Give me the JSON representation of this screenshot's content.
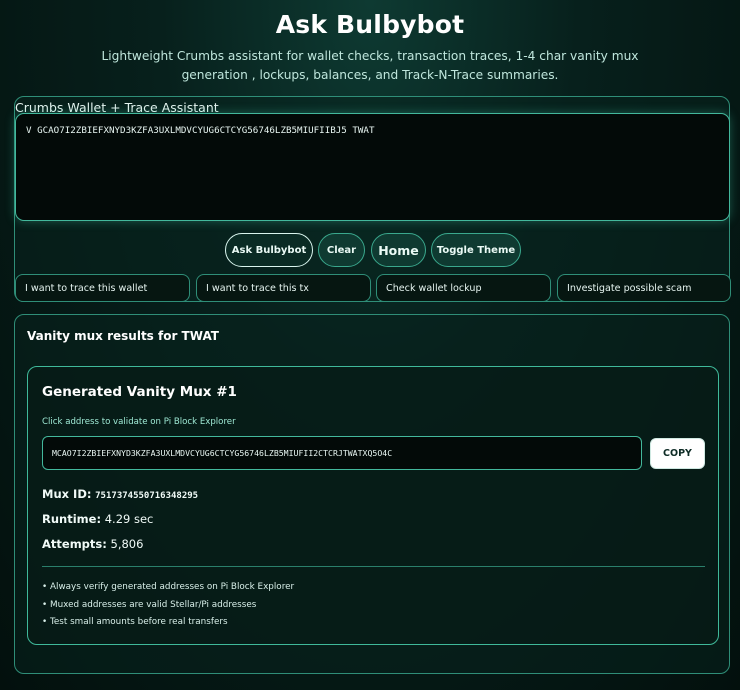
{
  "header": {
    "title": "Ask Bulbybot",
    "subtitle": "Lightweight Crumbs assistant for wallet checks, transaction traces, 1-4 char vanity mux generation , lockups, balances, and Track-N-Trace summaries."
  },
  "assistant": {
    "label": "Crumbs Wallet + Trace Assistant",
    "input_value": "V GCAO7I2ZBIEFXNYD3KZFA3UXLMDVCYUG6CTCYG56746LZB5MIUFIIBJ5 TWAT",
    "buttons": {
      "ask": "Ask Bulbybot",
      "clear": "Clear",
      "home": "Home",
      "theme": "Toggle Theme"
    },
    "quick_prompts": [
      "I want to trace this wallet",
      "I want to trace this tx",
      "Check wallet lockup",
      "Investigate possible scam"
    ]
  },
  "results": {
    "title": "Vanity mux results for TWAT",
    "card": {
      "title": "Generated Vanity Mux #1",
      "hint": "Click address to validate on Pi Block Explorer",
      "address": "MCAO7I2ZBIEFXNYD3KZFA3UXLMDVCYUG6CTCYG56746LZB5MIUFII2CTCRJTWATXQ5O4C",
      "copy_label": "COPY",
      "mux_id_label": "Mux ID:",
      "mux_id": "7517374550716348295",
      "runtime_label": "Runtime:",
      "runtime": "4.29 sec",
      "attempts_label": "Attempts:",
      "attempts": "5,806",
      "tips": [
        "• Always verify generated addresses on Pi Block Explorer",
        "• Muxed addresses are valid Stellar/Pi addresses",
        "• Test small amounts before real transfers"
      ]
    }
  }
}
